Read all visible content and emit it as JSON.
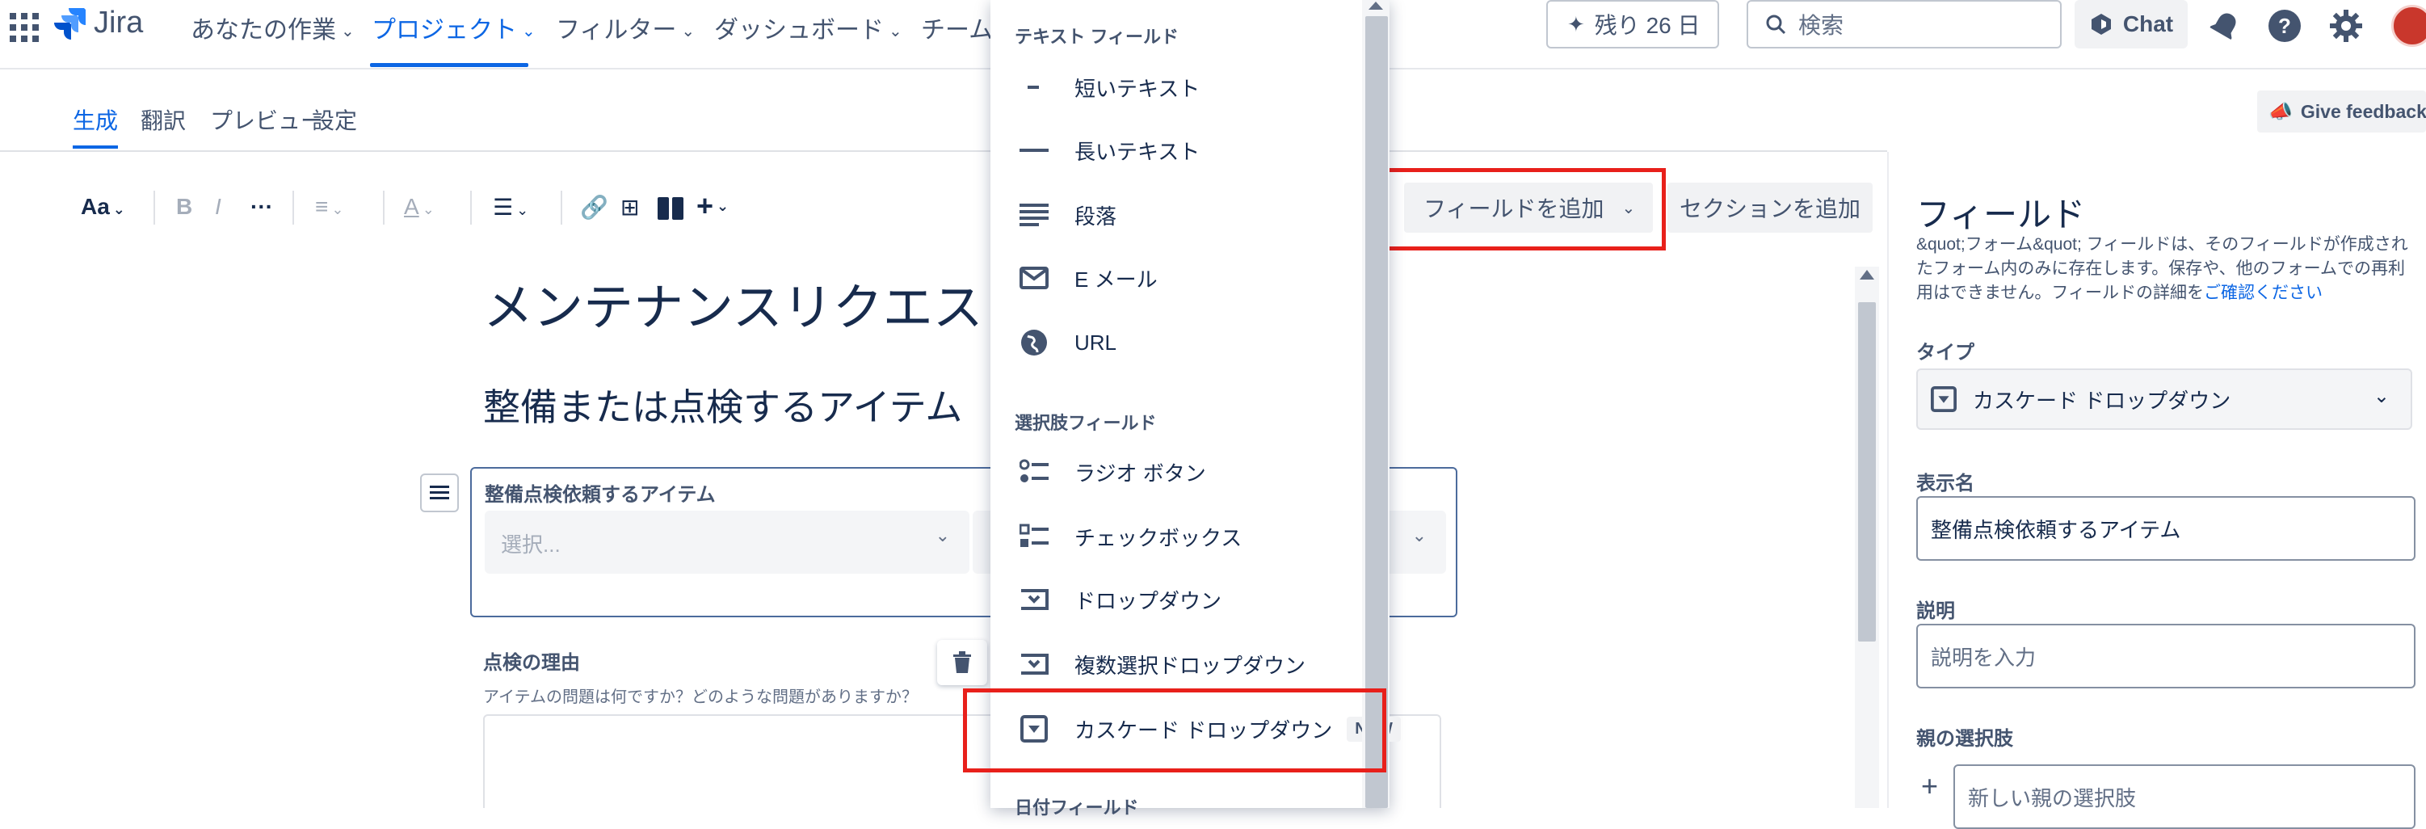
{
  "nav": {
    "logo_text": "Jira",
    "items": [
      {
        "label": "あなたの作業"
      },
      {
        "label": "プロジェクト"
      },
      {
        "label": "フィルター"
      },
      {
        "label": "ダッシュボード"
      },
      {
        "label": "チーム"
      }
    ],
    "trial_label": "残り 26 日",
    "search_placeholder": "検索",
    "chat_label": "Chat"
  },
  "subtabs": [
    "生成",
    "翻訳",
    "プレビュー",
    "設定"
  ],
  "feedback_label": "Give feedback",
  "toolbar": {
    "text_style": "Aa",
    "bold": "B",
    "italic": "I",
    "more": "···",
    "add_field": "フィールドを追加",
    "add_section": "セクションを追加"
  },
  "editor": {
    "title": "メンテナンスリクエスト",
    "subheading": "整備または点検するアイテム",
    "field1_label": "整備点検依頼するアイテム",
    "select_placeholder": "選択...",
    "field2_label": "点検の理由",
    "field2_hint": "アイテムの問題は何ですか？どのような問題がありますか？"
  },
  "dropdown": {
    "text_header": "テキスト フィールド",
    "text_items": [
      "短いテキスト",
      "長いテキスト",
      "段落",
      "E メール",
      "URL"
    ],
    "choice_header": "選択肢フィールド",
    "choice_items": [
      "ラジオ ボタン",
      "チェックボックス",
      "ドロップダウン",
      "複数選択ドロップダウン",
      "カスケード ドロップダウン"
    ],
    "new_badge": "NEW",
    "date_header": "日付フィールド"
  },
  "panel": {
    "title": "フィールド",
    "description": "&quot;フォーム&quot; フィールドは、そのフィールドが作成されたフォーム内のみに存在します。保存や、他のフォームでの再利用はできません。フィールドの詳細を",
    "link_text": "ご確認ください",
    "type_label": "タイプ",
    "type_value": "カスケード ドロップダウン",
    "display_name_label": "表示名",
    "display_name_value": "整備点検依頼するアイテム",
    "description_label": "説明",
    "description_placeholder": "説明を入力",
    "parent_label": "親の選択肢",
    "parent_placeholder": "新しい親の選択肢"
  },
  "colors": {
    "accent": "#0c66e4",
    "highlight": "#e8201b",
    "text": "#172b4d"
  }
}
